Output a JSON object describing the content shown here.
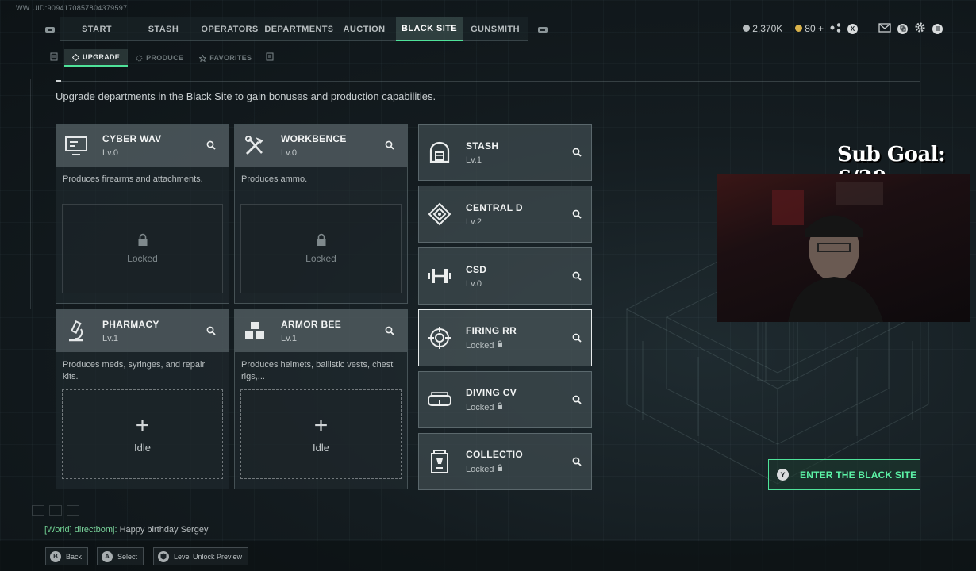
{
  "uid": "WW UID:9094170857804379597",
  "nav": {
    "tabs": [
      {
        "label": "START"
      },
      {
        "label": "STASH"
      },
      {
        "label": "OPERATORS"
      },
      {
        "label": "DEPARTMENTS"
      },
      {
        "label": "AUCTION"
      },
      {
        "label": "BLACK SITE",
        "active": true
      },
      {
        "label": "GUNSMITH"
      }
    ],
    "active_tab": "BLACK SITE"
  },
  "currency": {
    "koens": "2,370K",
    "coins": "80",
    "plus": "+",
    "x_button": "X",
    "coin_color_silver": "#b7bcbe",
    "coin_color_gold": "#d9b24a"
  },
  "subnav": {
    "tabs": [
      {
        "label": "UPGRADE",
        "active": true
      },
      {
        "label": "PRODUCE"
      },
      {
        "label": "FAVORITES"
      }
    ]
  },
  "description": "Upgrade departments in the Black Site to gain bonuses and production capabilities.",
  "departments": [
    {
      "name": "CYBER WAV",
      "level": "Lv.0",
      "desc": "Produces firearms and attachments.",
      "status": "Locked",
      "icon": "monitor-icon"
    },
    {
      "name": "WORKBENCE",
      "level": "Lv.0",
      "desc": "Produces ammo.",
      "status": "Locked",
      "icon": "tools-icon"
    },
    {
      "name": "PHARMACY",
      "level": "Lv.1",
      "desc": "Produces meds, syringes, and repair kits.",
      "status": "Idle",
      "icon": "microscope-icon"
    },
    {
      "name": "ARMOR BEE",
      "level": "Lv.1",
      "desc": "Produces helmets, ballistic vests, chest rigs,...",
      "status": "Idle",
      "icon": "cubes-icon"
    }
  ],
  "facilities": [
    {
      "name": "STASH",
      "level": "Lv.1",
      "icon": "vault-icon"
    },
    {
      "name": "CENTRAL D",
      "level": "Lv.2",
      "icon": "diamond-pattern-icon"
    },
    {
      "name": "CSD",
      "level": "Lv.0",
      "icon": "dumbbell-icon"
    },
    {
      "name": "FIRING RR",
      "level": "Locked",
      "icon": "target-icon",
      "selected": true
    },
    {
      "name": "DIVING CV",
      "level": "Locked",
      "icon": "goggles-icon"
    },
    {
      "name": "COLLECTIO",
      "level": "Locked",
      "icon": "trophy-case-icon"
    }
  ],
  "overlay": {
    "sub_goal": "Sub Goal: 6/30"
  },
  "enter_button": {
    "key": "Y",
    "label": "ENTER THE BLACK SITE",
    "accent": "#4fe39a"
  },
  "chat": {
    "channel": "[World]",
    "user": "directbomj:",
    "message": "Happy birthday Sergey"
  },
  "hints": [
    {
      "key": "B",
      "label": "Back"
    },
    {
      "key": "A",
      "label": "Select"
    },
    {
      "key": "",
      "label": "Level Unlock Preview"
    }
  ]
}
